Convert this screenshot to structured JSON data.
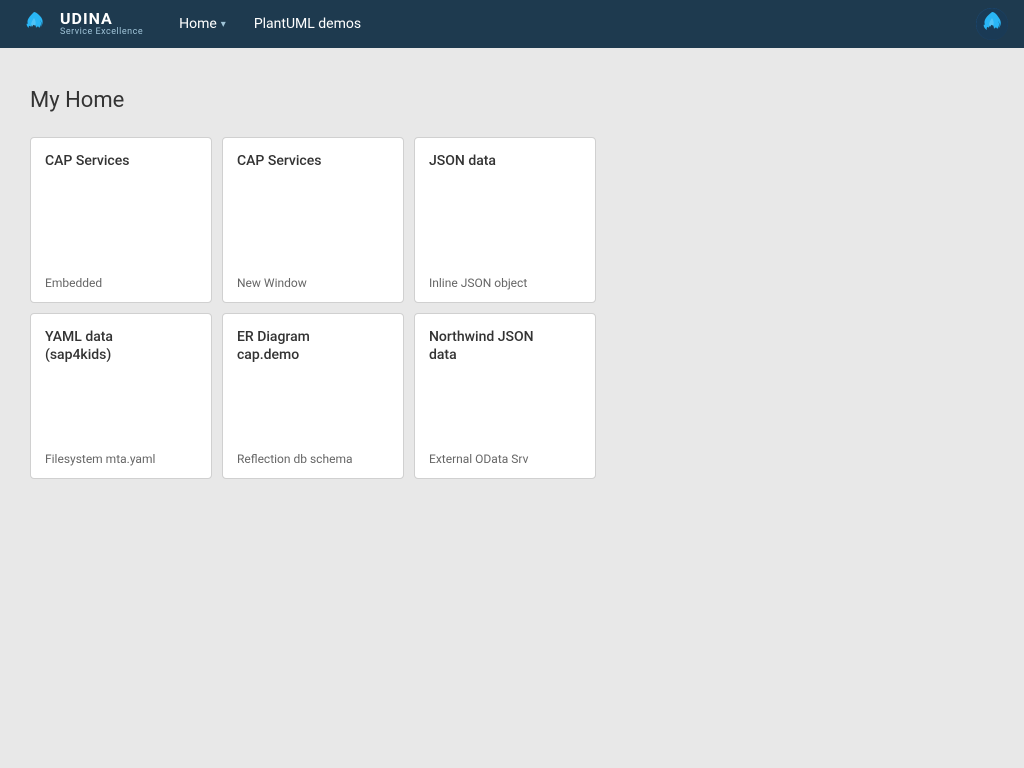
{
  "app": {
    "logo_title": "UDINA",
    "logo_subtitle": "Service Excellence",
    "nav_home_label": "Home",
    "nav_plantuml_label": "PlantUML demos"
  },
  "page": {
    "title": "My Home"
  },
  "cards": [
    {
      "id": "cap-embedded",
      "title": "CAP Services",
      "subtitle": "Embedded"
    },
    {
      "id": "cap-window",
      "title": "CAP Services",
      "subtitle": "New Window"
    },
    {
      "id": "json-data",
      "title": "JSON data",
      "subtitle": "Inline JSON object"
    },
    {
      "id": "yaml-data",
      "title": "YAML data\n(sap4kids)",
      "subtitle": "Filesystem mta.yaml"
    },
    {
      "id": "er-diagram",
      "title": "ER Diagram\ncap.demo",
      "subtitle": "Reflection db schema"
    },
    {
      "id": "northwind",
      "title": "Northwind JSON\ndata",
      "subtitle": "External OData Srv"
    }
  ]
}
